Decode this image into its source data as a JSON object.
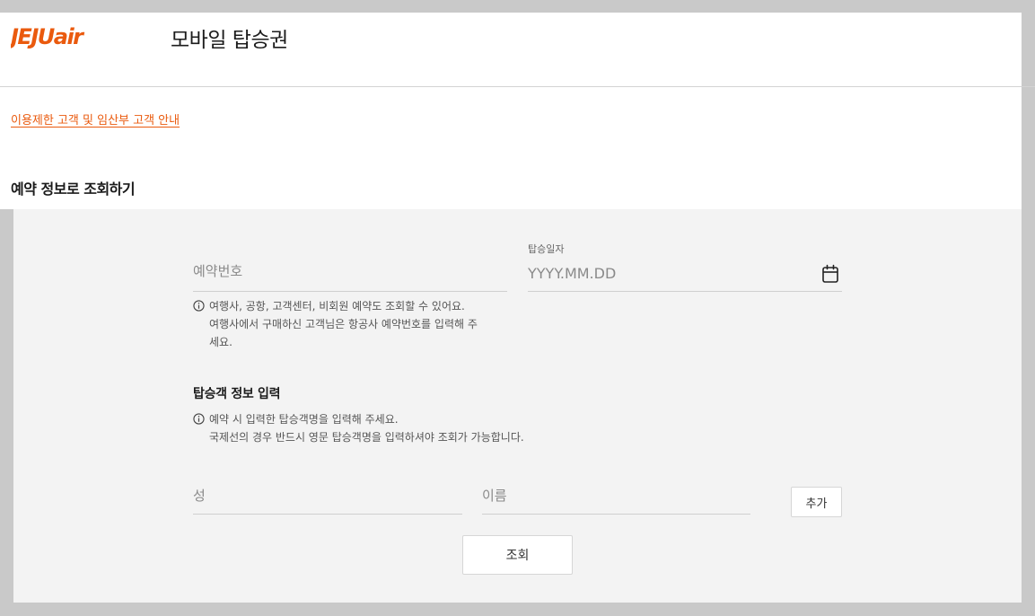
{
  "header": {
    "logo_text": "JEJUair",
    "title": "모바일 탑승권"
  },
  "notice_link": "이용제한 고객 및 임산부 고객 안내",
  "section_title": "예약 정보로 조회하기",
  "form": {
    "reservation_number": {
      "placeholder": "예약번호"
    },
    "boarding_date": {
      "label": "탑승일자",
      "placeholder": "YYYY.MM.DD",
      "icon": "calendar-icon"
    },
    "reservation_info": {
      "line1": "여행사, 공항, 고객센터, 비회원 예약도 조회할 수 있어요.",
      "line2": "여행사에서 구매하신 고객님은 항공사 예약번호를 입력해 주",
      "line3": "세요."
    },
    "passenger": {
      "title": "탑승객 정보 입력",
      "info_line1": "예약 시 입력한 탑승객명을 입력해 주세요.",
      "info_line2": "국제선의 경우 반드시 영문 탑승객명을 입력하셔야 조회가 가능합니다.",
      "last_name_placeholder": "성",
      "first_name_placeholder": "이름",
      "add_label": "추가"
    },
    "submit_label": "조회"
  },
  "colors": {
    "brand": "#ea5a0e",
    "panel": "#f3f3f3",
    "background": "#c9c9c9"
  }
}
